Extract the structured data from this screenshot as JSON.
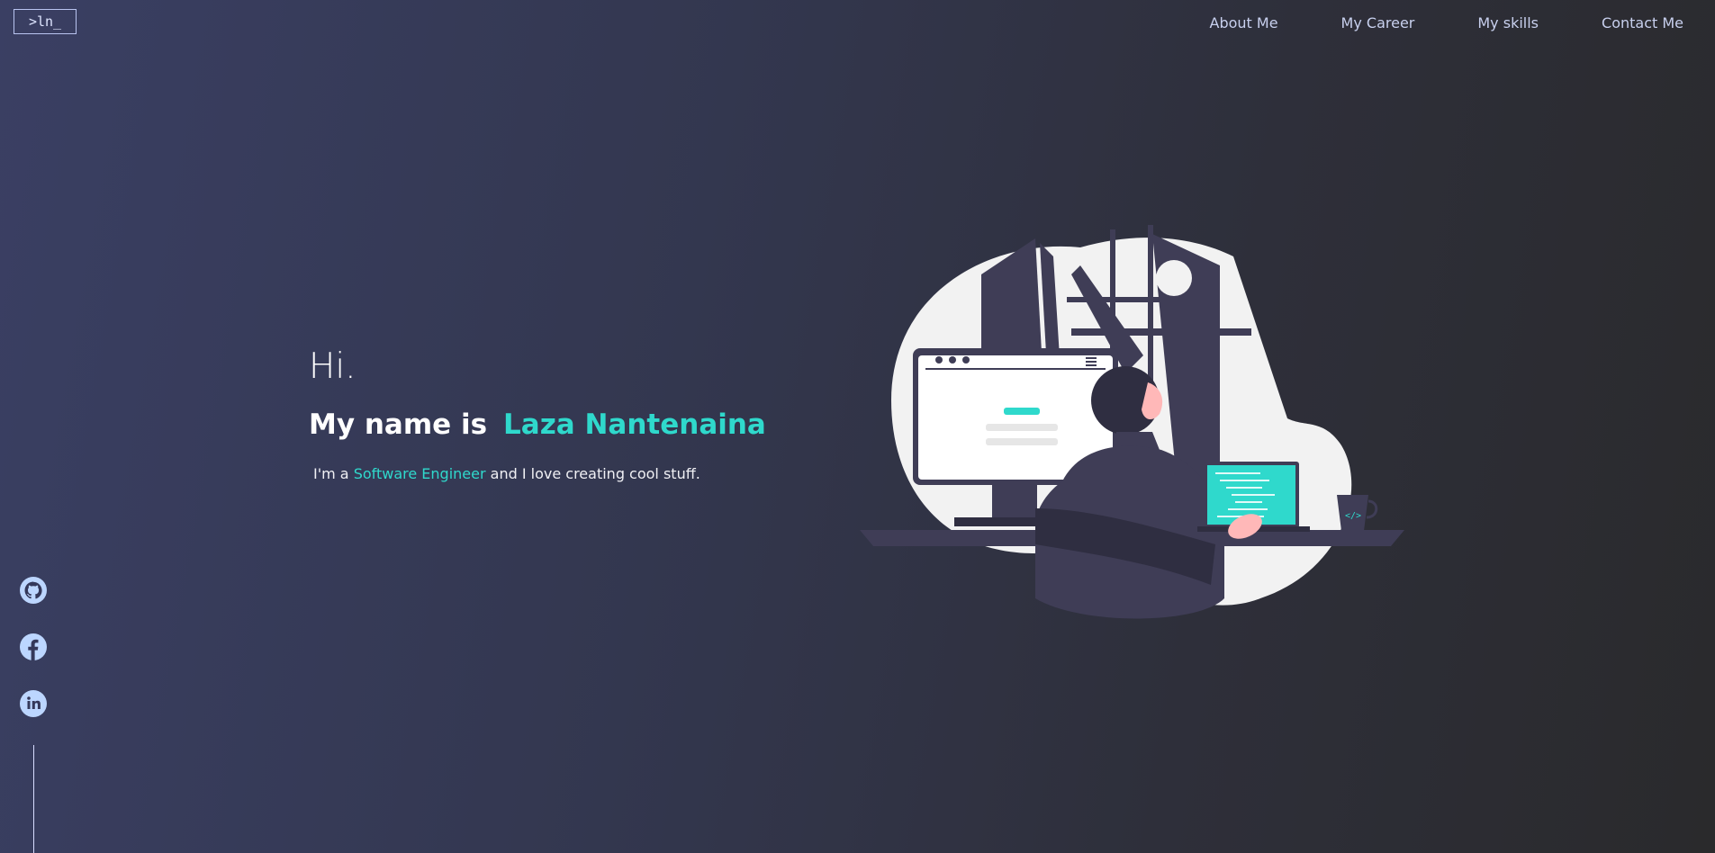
{
  "header": {
    "logo_text": ">ln_",
    "nav": [
      {
        "label": "About Me"
      },
      {
        "label": "My Career"
      },
      {
        "label": "My skills"
      },
      {
        "label": "Contact Me"
      }
    ]
  },
  "hero": {
    "greeting": "Hi.",
    "name_prefix": "My name is",
    "name": "Laza Nantenaina",
    "tagline_prefix": "I'm a",
    "tagline_role": "Software Engineer",
    "tagline_suffix": "and I love creating cool stuff."
  },
  "socials": [
    {
      "icon": "github-icon"
    },
    {
      "icon": "facebook-icon"
    },
    {
      "icon": "linkedin-icon"
    }
  ],
  "colors": {
    "accent": "#2fd9cc",
    "icon": "#bcd6ff",
    "illustration_dark": "#3f3d56",
    "illustration_light": "#f2f2f2"
  }
}
